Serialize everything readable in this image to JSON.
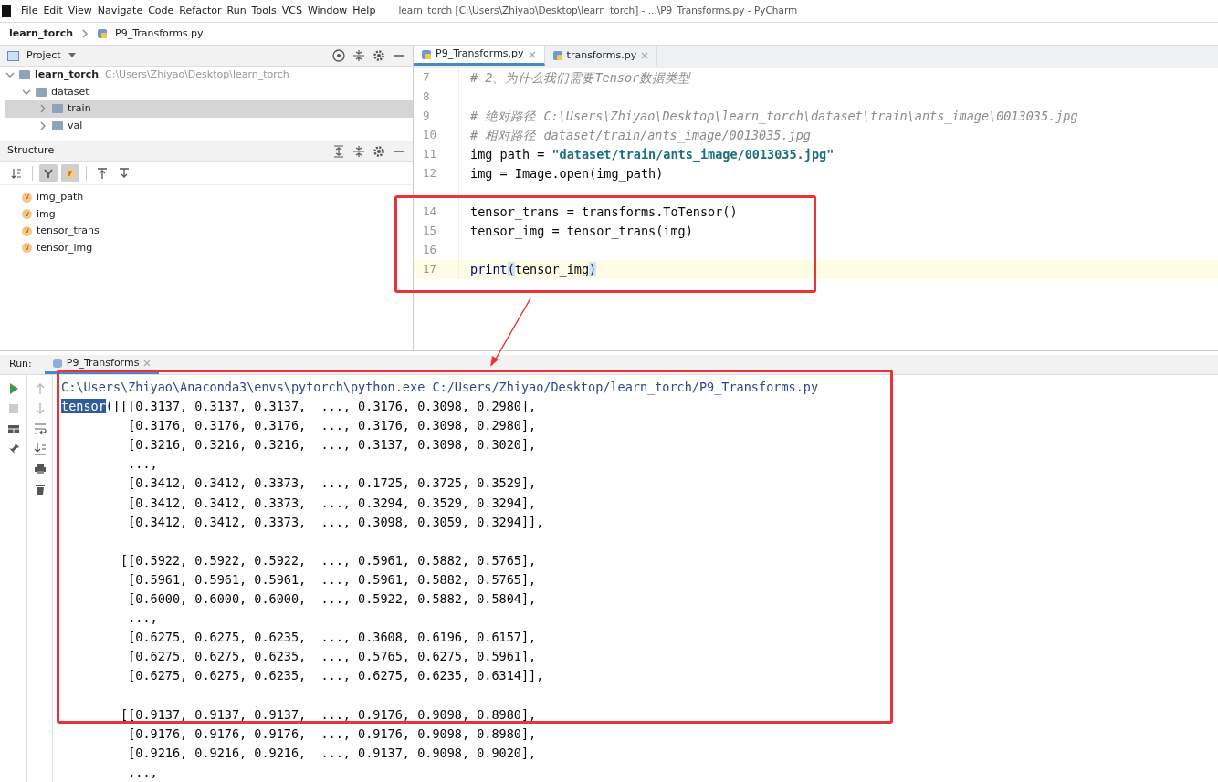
{
  "menu": [
    "File",
    "Edit",
    "View",
    "Navigate",
    "Code",
    "Refactor",
    "Run",
    "Tools",
    "VCS",
    "Window",
    "Help"
  ],
  "window": {
    "title": "learn_torch [C:\\Users\\Zhiyao\\Desktop\\learn_torch] - ...\\P9_Transforms.py - PyCharm"
  },
  "breadcrumb": [
    "learn_torch",
    "P9_Transforms.py"
  ],
  "project_panel": {
    "title": "Project",
    "tree": [
      {
        "label": "learn_torch",
        "path": "C:\\Users\\Zhiyao\\Desktop\\learn_torch",
        "expanded": true,
        "selected": false,
        "children": [
          {
            "label": "dataset",
            "expanded": true,
            "selected": false,
            "children": [
              {
                "label": "train",
                "expanded": false,
                "selected": true
              },
              {
                "label": "val",
                "expanded": false,
                "selected": false
              }
            ]
          }
        ]
      }
    ]
  },
  "structure_panel": {
    "title": "Structure",
    "toggles": [
      {
        "kind": "sort",
        "on": false
      },
      {
        "kind": "inherited",
        "on": true
      },
      {
        "kind": "fields",
        "on": true
      },
      {
        "kind": "expand",
        "on": false
      },
      {
        "kind": "collapse",
        "on": false
      }
    ],
    "items": [
      {
        "badge": "v",
        "label": "img_path"
      },
      {
        "badge": "v",
        "label": "img"
      },
      {
        "badge": "v",
        "label": "tensor_trans"
      },
      {
        "badge": "v",
        "label": "tensor_img"
      }
    ]
  },
  "editor": {
    "tabs": [
      {
        "label": "P9_Transforms.py",
        "selected": true
      },
      {
        "label": "transforms.py",
        "selected": false
      }
    ],
    "lines": [
      {
        "number": "7",
        "current": false,
        "parts": [
          {
            "kind": "comment",
            "text": "# 2、为什么我们需要Tensor数据类型"
          }
        ]
      },
      {
        "number": "8",
        "current": false
      },
      {
        "number": "9",
        "current": false,
        "parts": [
          {
            "kind": "comment",
            "text": "# 绝对路径 C:\\Users\\Zhiyao\\Desktop\\learn_torch\\dataset\\train\\ants_image\\0013035.jpg"
          }
        ]
      },
      {
        "number": "10",
        "current": false,
        "parts": [
          {
            "kind": "comment",
            "text": "# 相对路径 dataset/train/ants_image/0013035.jpg"
          }
        ]
      },
      {
        "number": "11",
        "current": false,
        "parts": [
          {
            "kind": "plain",
            "text": "img_path = "
          },
          {
            "kind": "string",
            "text": "\"dataset/train/ants_image/0013035.jpg\""
          }
        ]
      },
      {
        "number": "12",
        "current": false,
        "parts": [
          {
            "kind": "plain",
            "text": "img = Image.open(img_path)"
          }
        ]
      },
      {
        "current": false
      },
      {
        "number": "14",
        "current": false,
        "parts": [
          {
            "kind": "plain",
            "text": "tensor_trans = transforms.ToTensor()"
          }
        ]
      },
      {
        "number": "15",
        "current": false,
        "parts": [
          {
            "kind": "plain",
            "text": "tensor_img = tensor_trans(img)"
          }
        ]
      },
      {
        "number": "16",
        "current": false
      },
      {
        "number": "17",
        "current": true,
        "parts": [
          {
            "kind": "builtin",
            "text": "print"
          },
          {
            "kind": "brace",
            "text": "("
          },
          {
            "kind": "plain",
            "text": "tensor_img"
          },
          {
            "kind": "brace",
            "text": ")"
          }
        ]
      }
    ]
  },
  "run_panel": {
    "label": "Run:",
    "tab": "P9_Transforms",
    "output": [
      {
        "kind": "text",
        "parts": [
          {
            "kind": "command",
            "text": "C:\\Users\\Zhiyao\\Anaconda3\\envs\\pytorch\\python.exe C:/Users/Zhiyao/Desktop/learn_torch/P9_Transforms.py"
          }
        ]
      },
      {
        "kind": "text",
        "parts": [
          {
            "kind": "selection",
            "text": "tensor"
          },
          {
            "kind": "plain",
            "text": "([[[0.3137, 0.3137, 0.3137,  ..., 0.3176, 0.3098, 0.2980],"
          }
        ]
      },
      {
        "kind": "text",
        "parts": [
          {
            "kind": "plain",
            "text": "         [0.3176, 0.3176, 0.3176,  ..., 0.3176, 0.3098, 0.2980],"
          }
        ]
      },
      {
        "kind": "text",
        "parts": [
          {
            "kind": "plain",
            "text": "         [0.3216, 0.3216, 0.3216,  ..., 0.3137, 0.3098, 0.3020],"
          }
        ]
      },
      {
        "kind": "text",
        "parts": [
          {
            "kind": "plain",
            "text": "         ...,"
          }
        ]
      },
      {
        "kind": "text",
        "parts": [
          {
            "kind": "plain",
            "text": "         [0.3412, 0.3412, 0.3373,  ..., 0.1725, 0.3725, 0.3529],"
          }
        ]
      },
      {
        "kind": "text",
        "parts": [
          {
            "kind": "plain",
            "text": "         [0.3412, 0.3412, 0.3373,  ..., 0.3294, 0.3529, 0.3294],"
          }
        ]
      },
      {
        "kind": "text",
        "parts": [
          {
            "kind": "plain",
            "text": "         [0.3412, 0.3412, 0.3373,  ..., 0.3098, 0.3059, 0.3294]],"
          }
        ]
      },
      {
        "kind": "blank"
      },
      {
        "kind": "text",
        "parts": [
          {
            "kind": "plain",
            "text": "        [[0.5922, 0.5922, 0.5922,  ..., 0.5961, 0.5882, 0.5765],"
          }
        ]
      },
      {
        "kind": "text",
        "parts": [
          {
            "kind": "plain",
            "text": "         [0.5961, 0.5961, 0.5961,  ..., 0.5961, 0.5882, 0.5765],"
          }
        ]
      },
      {
        "kind": "text",
        "parts": [
          {
            "kind": "plain",
            "text": "         [0.6000, 0.6000, 0.6000,  ..., 0.5922, 0.5882, 0.5804],"
          }
        ]
      },
      {
        "kind": "text",
        "parts": [
          {
            "kind": "plain",
            "text": "         ...,"
          }
        ]
      },
      {
        "kind": "text",
        "parts": [
          {
            "kind": "plain",
            "text": "         [0.6275, 0.6275, 0.6235,  ..., 0.3608, 0.6196, 0.6157],"
          }
        ]
      },
      {
        "kind": "text",
        "parts": [
          {
            "kind": "plain",
            "text": "         [0.6275, 0.6275, 0.6235,  ..., 0.5765, 0.6275, 0.5961],"
          }
        ]
      },
      {
        "kind": "text",
        "parts": [
          {
            "kind": "plain",
            "text": "         [0.6275, 0.6275, 0.6235,  ..., 0.6275, 0.6235, 0.6314]],"
          }
        ]
      },
      {
        "kind": "blank"
      },
      {
        "kind": "text",
        "parts": [
          {
            "kind": "plain",
            "text": "        [[0.9137, 0.9137, 0.9137,  ..., 0.9176, 0.9098, 0.8980],"
          }
        ]
      },
      {
        "kind": "text",
        "parts": [
          {
            "kind": "plain",
            "text": "         [0.9176, 0.9176, 0.9176,  ..., 0.9176, 0.9098, 0.8980],"
          }
        ]
      },
      {
        "kind": "text",
        "parts": [
          {
            "kind": "plain",
            "text": "         [0.9216, 0.9216, 0.9216,  ..., 0.9137, 0.9098, 0.9020],"
          }
        ]
      },
      {
        "kind": "text",
        "parts": [
          {
            "kind": "plain",
            "text": "         ...,"
          }
        ]
      }
    ]
  }
}
